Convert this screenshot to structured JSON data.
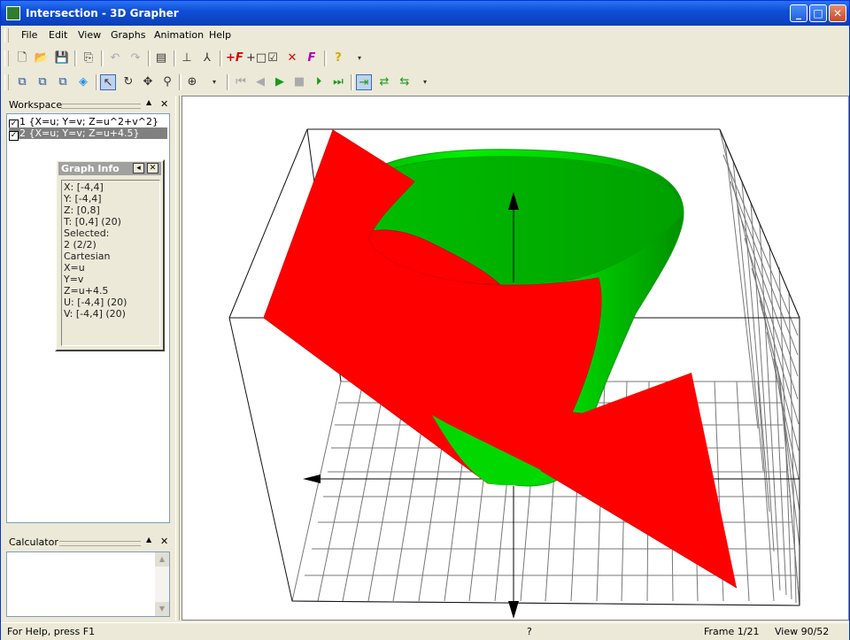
{
  "window": {
    "title": "Intersection - 3D Grapher"
  },
  "titlebar_buttons": {
    "minimize": "_",
    "maximize": "□",
    "close": "✕"
  },
  "menu": [
    "File",
    "Edit",
    "View",
    "Graphs",
    "Animation",
    "Help"
  ],
  "workspace": {
    "title": "Workspace",
    "items": [
      {
        "label": "1 {X=u; Y=v; Z=u^2+v^2}",
        "checked": true,
        "selected": false
      },
      {
        "label": "2 {X=u; Y=v; Z=u+4.5}",
        "checked": true,
        "selected": true
      }
    ]
  },
  "graph_info": {
    "title": "Graph Info",
    "lines": [
      "X: [-4,4]",
      "Y: [-4,4]",
      "Z: [0,8]",
      "T: [0,4] (20)",
      "Selected:",
      "2 (2/2)",
      "Cartesian",
      "X=u",
      "Y=v",
      "Z=u+4.5",
      "U: [-4,4] (20)",
      "V: [-4,4] (20)"
    ]
  },
  "calculator": {
    "title": "Calculator"
  },
  "status": {
    "help": "For Help, press F1",
    "middle": "?",
    "frame": "Frame 1/21",
    "view": "View 90/52"
  },
  "colors": {
    "paraboloid": "#00e000",
    "plane": "#ff0000",
    "titlebar": "#0a3fb8",
    "selection": "#808080"
  },
  "icons": [
    "new-icon",
    "open-icon",
    "save-icon",
    "copy-icon",
    "undo-icon",
    "redo-icon",
    "properties-icon",
    "axes-icon",
    "axes-3d-icon",
    "add-function-icon",
    "add-graph-icon",
    "graph-settings-icon",
    "delete-graph-icon",
    "function-icon",
    "help-icon",
    "view-front-icon",
    "view-side-icon",
    "view-top-icon",
    "view-iso-icon",
    "select-icon",
    "rotate-icon",
    "move-icon",
    "zoom-icon",
    "zoom-fit-icon",
    "first-frame-icon",
    "prev-frame-icon",
    "play-icon",
    "stop-icon",
    "next-frame-icon",
    "last-frame-icon",
    "anim-once-icon",
    "anim-loop-icon",
    "anim-bounce-icon"
  ]
}
